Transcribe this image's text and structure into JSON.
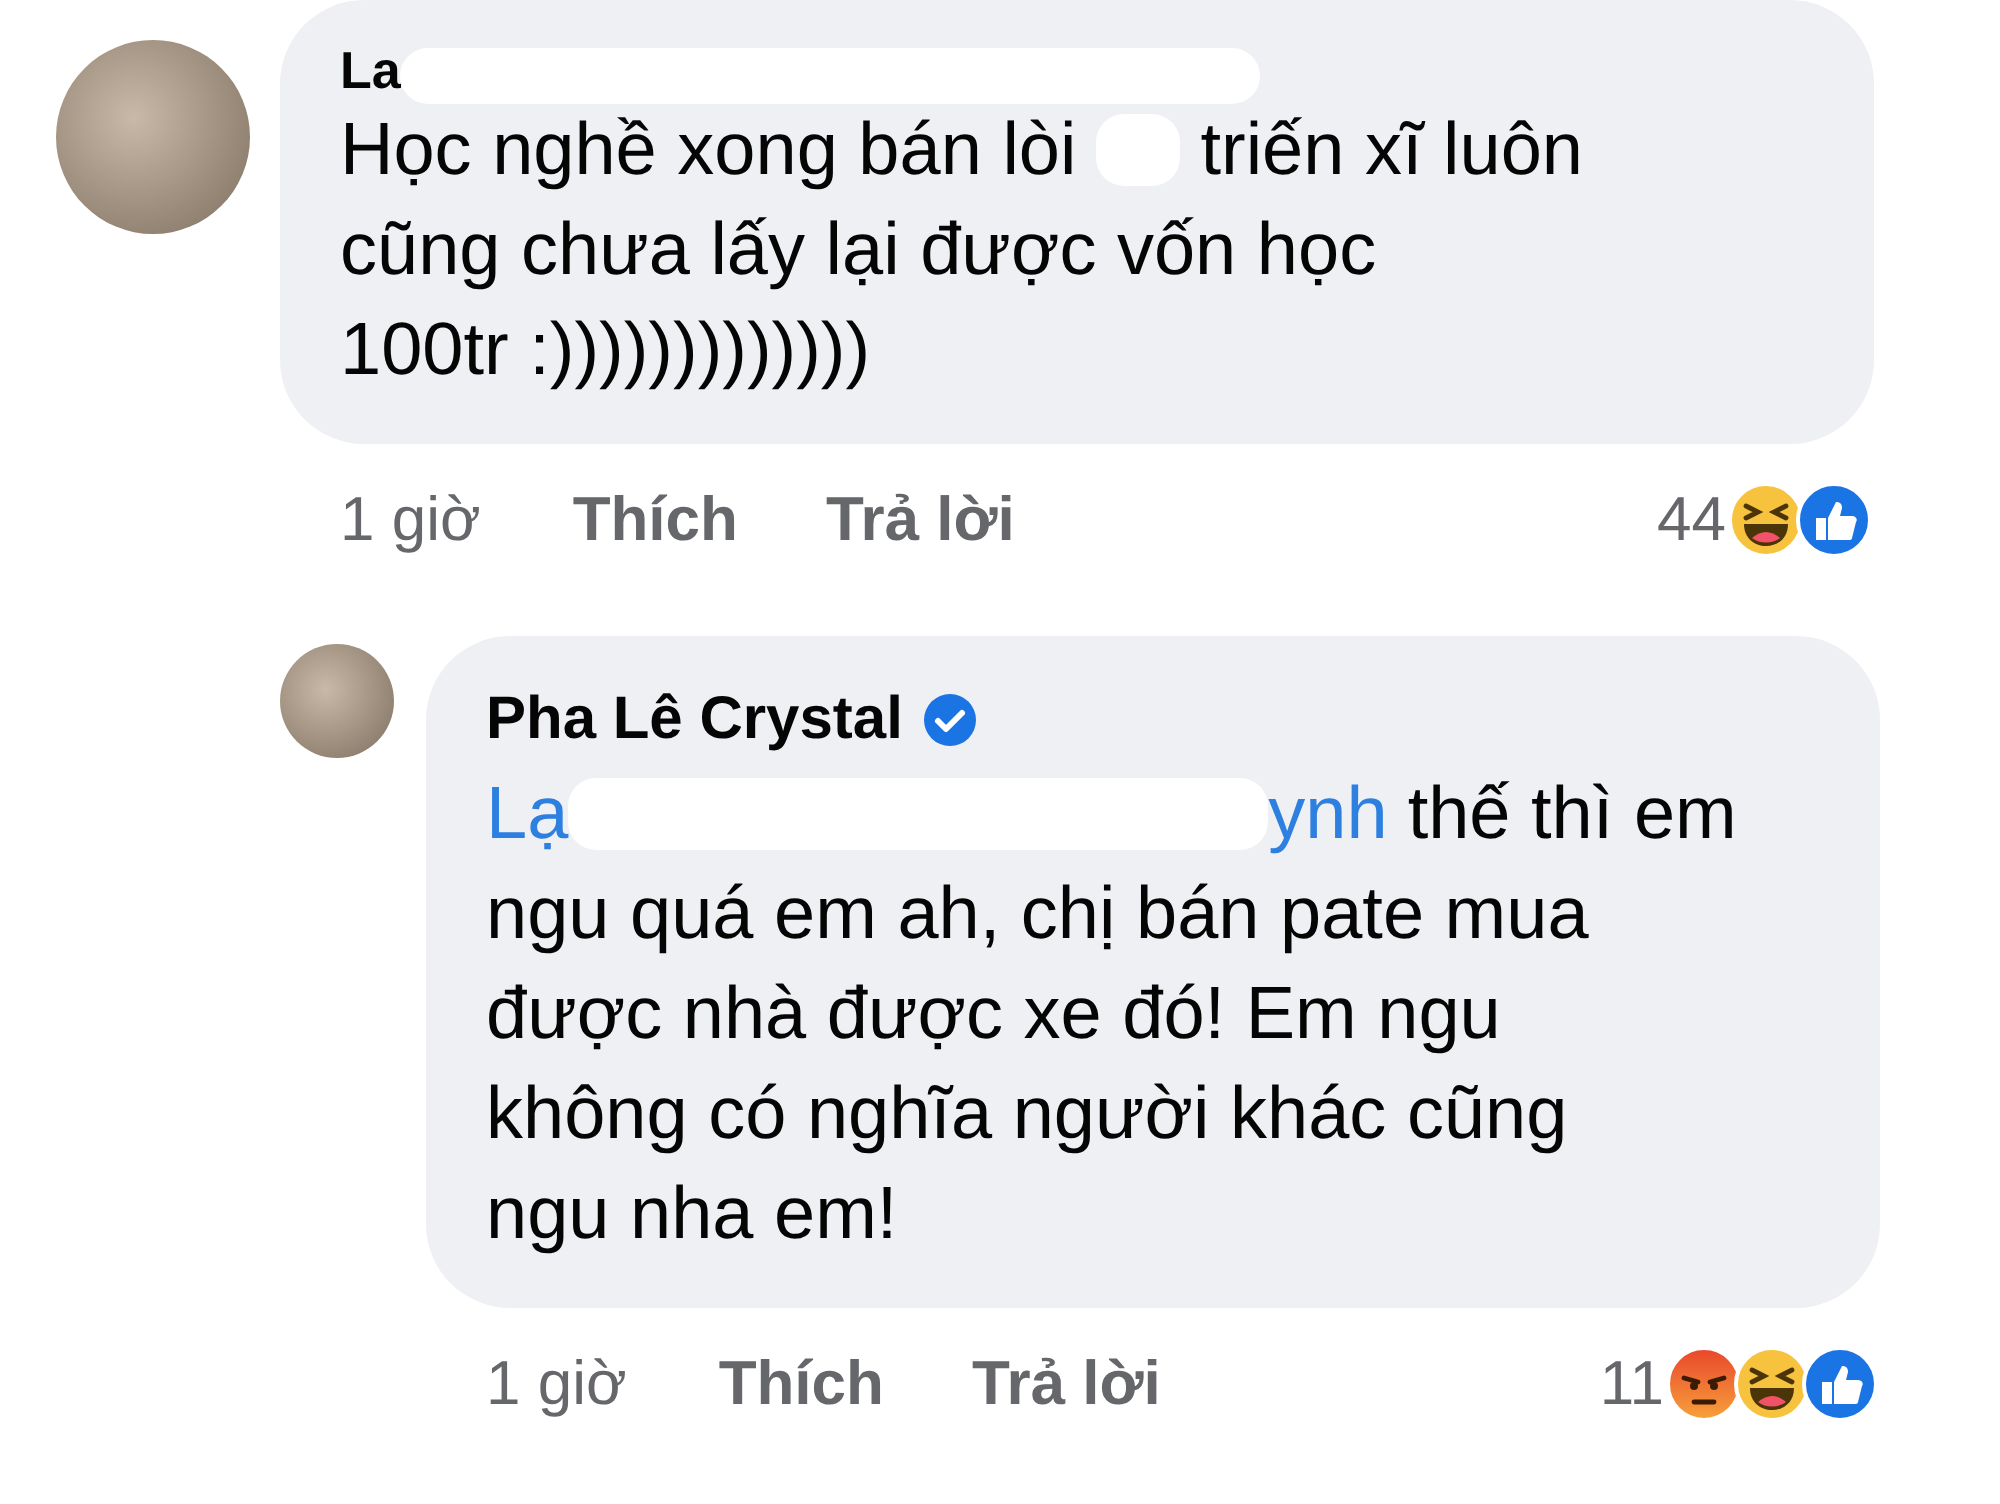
{
  "comments": [
    {
      "kind": "comment",
      "author": "La",
      "time": "1 giờ",
      "like_label": "Thích",
      "reply_label": "Trả lời",
      "reaction_count": "44",
      "reactions": [
        {
          "kind": "haha"
        },
        {
          "kind": "like"
        }
      ],
      "lines": [
        [
          {
            "kind": "text",
            "text": "Học nghề xong bán lòi"
          },
          {
            "kind": "redacted"
          },
          {
            "kind": "text",
            "text": "triến xĩ luôn"
          }
        ],
        [
          {
            "kind": "text",
            "text": "cũng chưa lấy lại được vốn học"
          }
        ],
        [
          {
            "kind": "text",
            "text": "100tr  :)))))))))))))"
          }
        ]
      ]
    },
    {
      "kind": "reply",
      "author": "Pha Lê Crystal",
      "author_verified": true,
      "time": "1 giờ",
      "like_label": "Thích",
      "reply_label": "Trả lời",
      "reaction_count": "11",
      "reactions": [
        {
          "kind": "angry"
        },
        {
          "kind": "haha"
        },
        {
          "kind": "like"
        }
      ],
      "lines": [
        [
          {
            "kind": "mention",
            "text": "Lạ"
          },
          {
            "kind": "redacted"
          },
          {
            "kind": "mention",
            "text": "ynh"
          },
          {
            "kind": "text",
            "text": "thế thì em"
          }
        ],
        [
          {
            "kind": "text",
            "text": "ngu quá em ah, chị bán pate mua"
          }
        ],
        [
          {
            "kind": "text",
            "text": "được nhà được xe đó! Em ngu"
          }
        ],
        [
          {
            "kind": "text",
            "text": "không có nghĩa người khác cũng"
          }
        ],
        [
          {
            "kind": "text",
            "text": "ngu nha em!"
          }
        ]
      ]
    }
  ]
}
